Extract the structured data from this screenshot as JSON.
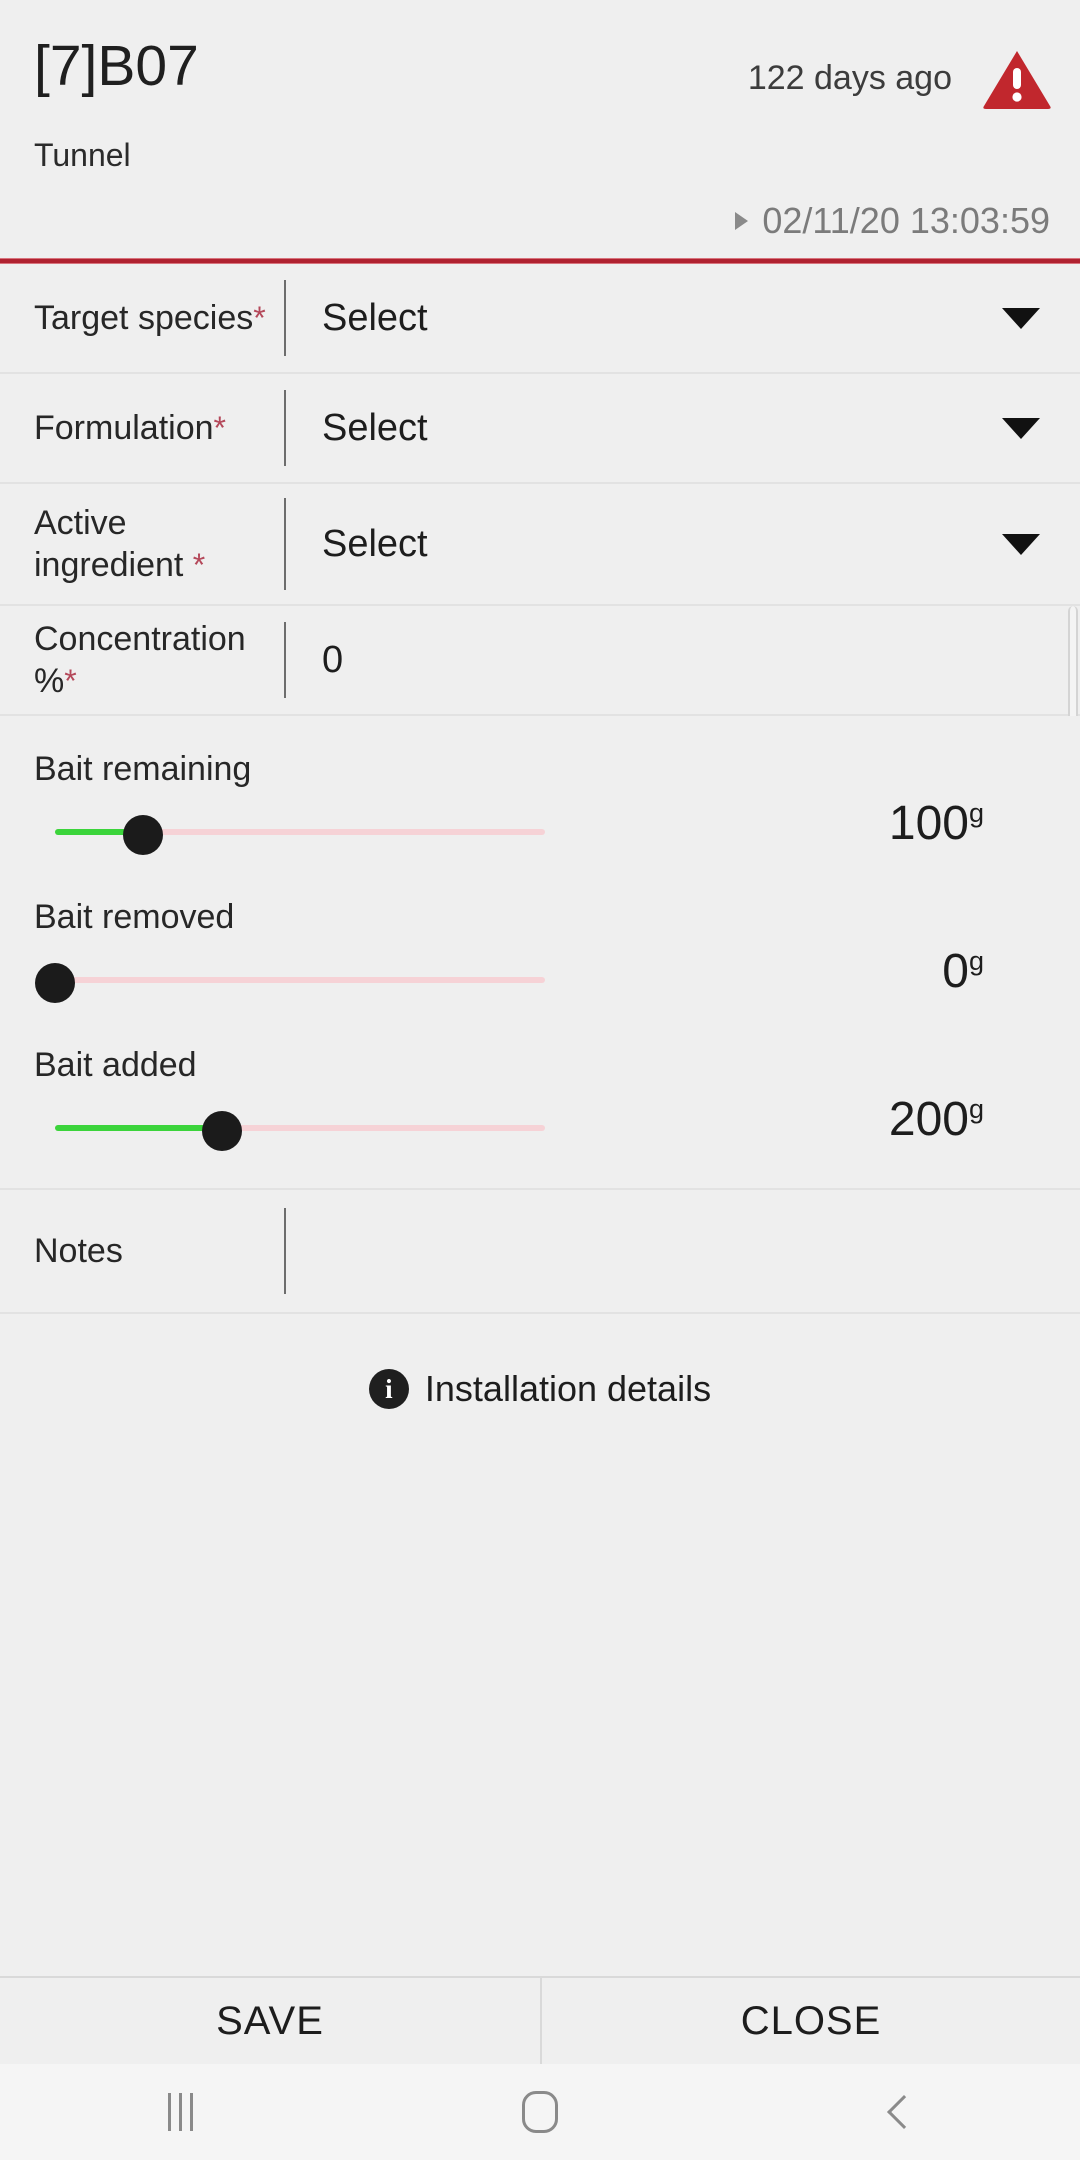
{
  "header": {
    "title": "[7]B07",
    "subtitle": "Tunnel",
    "age_text": "122 days ago",
    "timestamp": "02/11/20 13:03:59",
    "warning_icon": "warning-triangle-icon",
    "expand_icon": "triangle-right-icon",
    "accent_color": "#b02230"
  },
  "fields": [
    {
      "label": "Target species",
      "required": "*",
      "value": "Select",
      "control": "dropdown"
    },
    {
      "label": "Formulation",
      "required": "*",
      "value": "Select",
      "control": "dropdown"
    },
    {
      "label": "Active ingredient",
      "required": "*",
      "value": "Select",
      "control": "dropdown"
    },
    {
      "label": "Concentration %",
      "required": "*",
      "value": "0",
      "control": "text"
    }
  ],
  "sliders": [
    {
      "label": "Bait remaining",
      "value": "100",
      "unit": "g",
      "percent": 18
    },
    {
      "label": "Bait removed",
      "value": "0",
      "unit": "g",
      "percent": 0
    },
    {
      "label": "Bait added",
      "value": "200",
      "unit": "g",
      "percent": 34
    }
  ],
  "slider_colors": {
    "fill": "#3bd43b",
    "track": "#f6d2d6",
    "thumb": "#1b1b1b"
  },
  "notes": {
    "label": "Notes",
    "value": ""
  },
  "install": {
    "icon": "info-circle-icon",
    "label": "Installation details"
  },
  "buttons": {
    "save": "SAVE",
    "close": "CLOSE"
  },
  "navbar": {
    "recents": "recents-icon",
    "home": "home-icon",
    "back": "back-icon"
  }
}
